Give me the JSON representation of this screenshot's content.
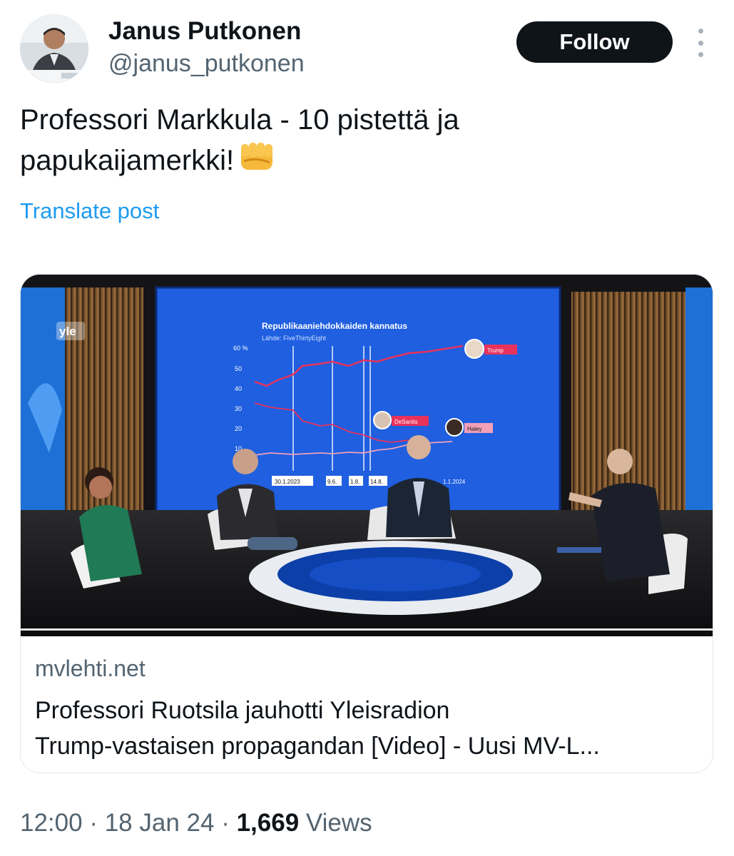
{
  "author": {
    "name": "Janus Putkonen",
    "handle": "@janus_putkonen"
  },
  "follow_label": "Follow",
  "post": {
    "text_line1": "Professori Markkula - 10 pistettä ja",
    "text_line2": "papukaijamerkki!",
    "emoji": "oncoming-fist"
  },
  "translate_label": "Translate post",
  "link_card": {
    "domain": "mvlehti.net",
    "title_line1": "Professori Ruotsila jauhotti Yleisradion",
    "title_line2": "Trump-vastaisen propagandan [Video] - Uusi MV-L...",
    "media": {
      "channel_logo": "yle",
      "chart_title": "Republikaaniehdokkaiden kannatus",
      "chart_source": "Lähde: FiveThirtyEight",
      "y_ticks": [
        "60 %",
        "50",
        "40",
        "30",
        "20",
        "10"
      ],
      "x_labels": [
        "30.1.2023",
        "9.6.",
        "1.8.",
        "14.8.",
        "1.1.2024"
      ],
      "series_labels": [
        "Trump",
        "DeSantis",
        "Haley"
      ]
    }
  },
  "meta": {
    "time": "12:00",
    "date": "18 Jan 24",
    "views_count": "1,669",
    "views_label": "Views",
    "separator": "·"
  },
  "colors": {
    "link": "#1d9bf0",
    "secondary_text": "#536471",
    "primary_text": "#0f1419",
    "follow_bg": "#0f1419"
  }
}
